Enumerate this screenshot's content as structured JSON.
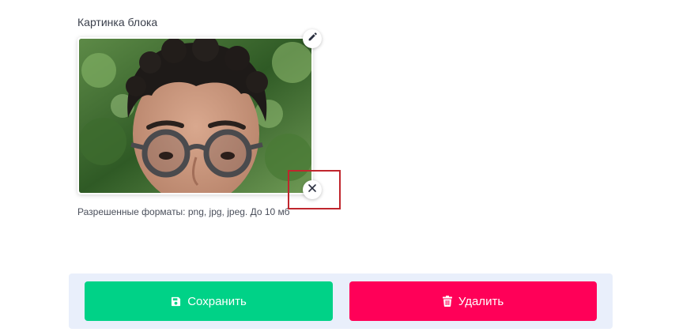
{
  "field": {
    "label": "Картинка блока",
    "hint": "Разрешенные форматы: png, jpg, jpeg. До 10 мб"
  },
  "image": {
    "content": "portrait photo of a smiling man with dark curly hair and round glasses against green foliage"
  },
  "icons": {
    "edit": "pencil-icon",
    "remove": "close-icon",
    "save": "floppy-disk-icon",
    "delete": "trash-icon"
  },
  "actions": {
    "save_label": "Сохранить",
    "delete_label": "Удалить"
  },
  "colors": {
    "save": "#00d287",
    "delete": "#ff0058",
    "action_bar": "#e9effb",
    "highlight": "#c0262d"
  }
}
